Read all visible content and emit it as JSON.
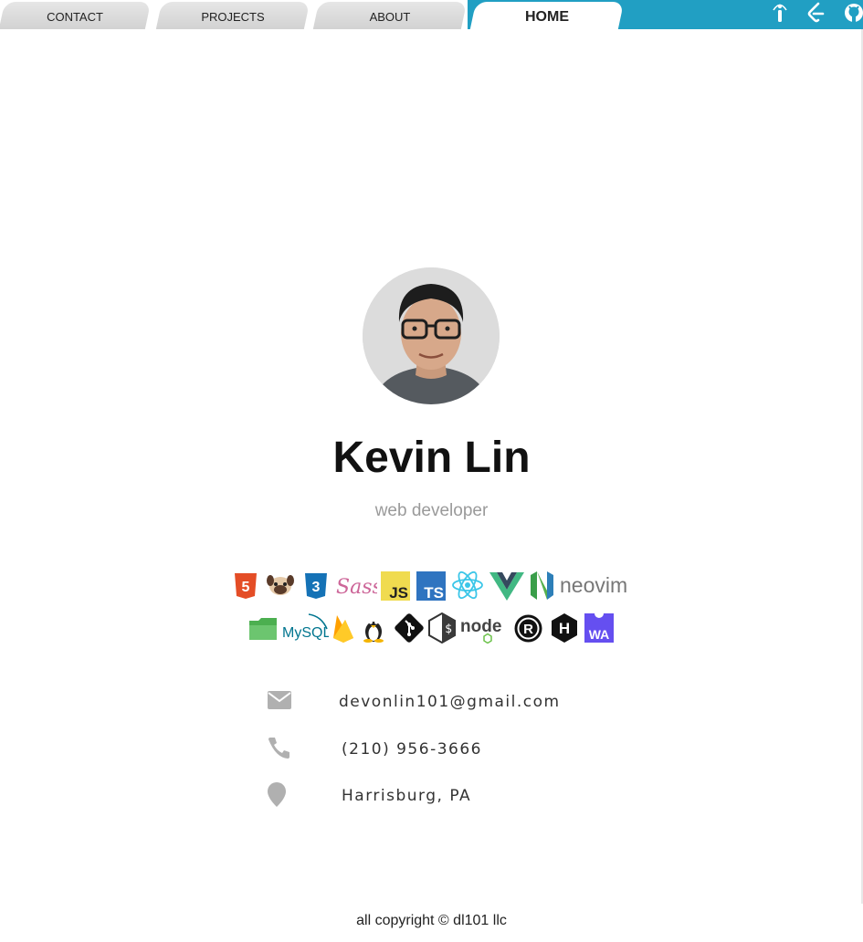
{
  "nav": {
    "tabs": [
      {
        "label": "CONTACT",
        "active": false
      },
      {
        "label": "PROJECTS",
        "active": false
      },
      {
        "label": "ABOUT",
        "active": false
      },
      {
        "label": "HOME",
        "active": true
      }
    ],
    "right_icons": [
      "info-icon",
      "leetcode-icon",
      "github-icon"
    ],
    "accent_color": "#219fc3"
  },
  "profile": {
    "name": "Kevin Lin",
    "role": "web developer"
  },
  "tech": {
    "row1": [
      {
        "icon": "html5-icon",
        "text": "5"
      },
      {
        "icon": "pug-icon",
        "text": ""
      },
      {
        "icon": "css3-icon",
        "text": "3"
      },
      {
        "icon": "sass-icon",
        "text": "Sass"
      },
      {
        "icon": "javascript-icon",
        "text": "JS"
      },
      {
        "icon": "typescript-icon",
        "text": "TS"
      },
      {
        "icon": "react-icon",
        "text": ""
      },
      {
        "icon": "vue-icon",
        "text": ""
      },
      {
        "icon": "neovim-icon",
        "text": "neovim"
      }
    ],
    "row2": [
      {
        "icon": "folder-icon",
        "text": ""
      },
      {
        "icon": "mysql-icon",
        "text": "MySQL"
      },
      {
        "icon": "firebase-icon",
        "text": ""
      },
      {
        "icon": "linux-icon",
        "text": ""
      },
      {
        "icon": "git-icon",
        "text": ""
      },
      {
        "icon": "bash-icon",
        "text": "$"
      },
      {
        "icon": "nodejs-icon",
        "text": "node"
      },
      {
        "icon": "rust-icon",
        "text": "R"
      },
      {
        "icon": "hashnode-icon",
        "text": "H"
      },
      {
        "icon": "webassembly-icon",
        "text": "WA"
      }
    ]
  },
  "contact": {
    "email": "devonlin101@gmail.com",
    "phone": "(210) 956-3666",
    "location": "Harrisburg, PA",
    "icons": [
      "envelope-icon",
      "phone-icon",
      "map-marker-icon"
    ],
    "icon_color": "#b0b0b0"
  },
  "footer": {
    "text": "all copyright © dl101 llc"
  }
}
